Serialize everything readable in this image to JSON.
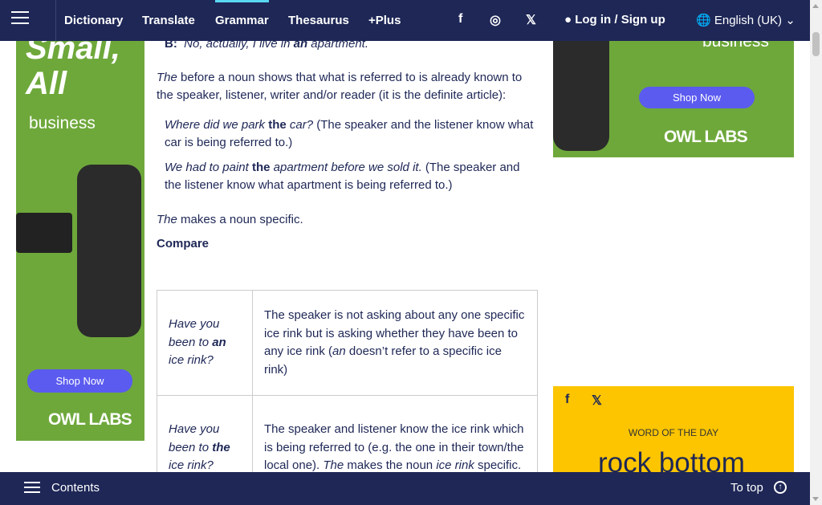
{
  "header": {
    "nav": [
      {
        "label": "Dictionary"
      },
      {
        "label": "Translate"
      },
      {
        "label": "Grammar"
      },
      {
        "label": "Thesaurus"
      },
      {
        "label": "+Plus"
      }
    ],
    "social": {
      "facebook": "f",
      "instagram": "◎",
      "x": "𝕏"
    },
    "login": "Log in",
    "slash": "/",
    "signup": "Sign up",
    "language": "English (UK)"
  },
  "ad_left": {
    "headline": "Small, All",
    "sub": "business",
    "cta": "Shop Now",
    "brand": "OWL LABS"
  },
  "ad_right": {
    "sub": "business",
    "cta": "Shop Now",
    "brand": "OWL LABS"
  },
  "content": {
    "dialog_b": {
      "speaker": "B:",
      "pre": "No, actually, I live in ",
      "bold": "an",
      "post": " apartment."
    },
    "p1": {
      "it": "The",
      "rest": " before a noun shows that what is referred to is already known to the speaker, listener, writer and/or reader (it is the definite article):"
    },
    "ex1": {
      "it1": "Where did we park ",
      "bold": "the",
      "it2": " car?",
      "rest": " (The speaker and the listener know what car is being referred to.)"
    },
    "ex2": {
      "it1": "We had to paint ",
      "bold": "the",
      "it2": " apartment before we sold it.",
      "rest": " (The speaker and the listener know what apartment is being referred to.)"
    },
    "p2": {
      "it": "The",
      "rest": " makes a noun specific."
    },
    "compare": "Compare",
    "table": [
      {
        "q_pre": "Have you been to ",
        "q_bold": "an",
        "q_post": " ice rink?",
        "a1": "The speaker is not asking about any one specific ice rink but is asking whether they have been to any ice rink (",
        "a_it": "an",
        "a2": " doesn’t refer to a specific ice rink)"
      },
      {
        "q_pre": "Have you been to ",
        "q_bold": "the",
        "q_post": " ice rink?",
        "a1": "The speaker and listener know the ice rink which is being referred to (e.g. the one in their town/the local one). ",
        "a_it": "The",
        "a2": " makes the noun ",
        "a_it2": "ice rink",
        "a3": " specific."
      }
    ]
  },
  "word_of_the_day": {
    "label": "WORD OF THE DAY",
    "word": "rock bottom",
    "facebook": "f",
    "x": "𝕏"
  },
  "footer": {
    "contents": "Contents",
    "to_top": "To top",
    "up_icon": "↑"
  }
}
